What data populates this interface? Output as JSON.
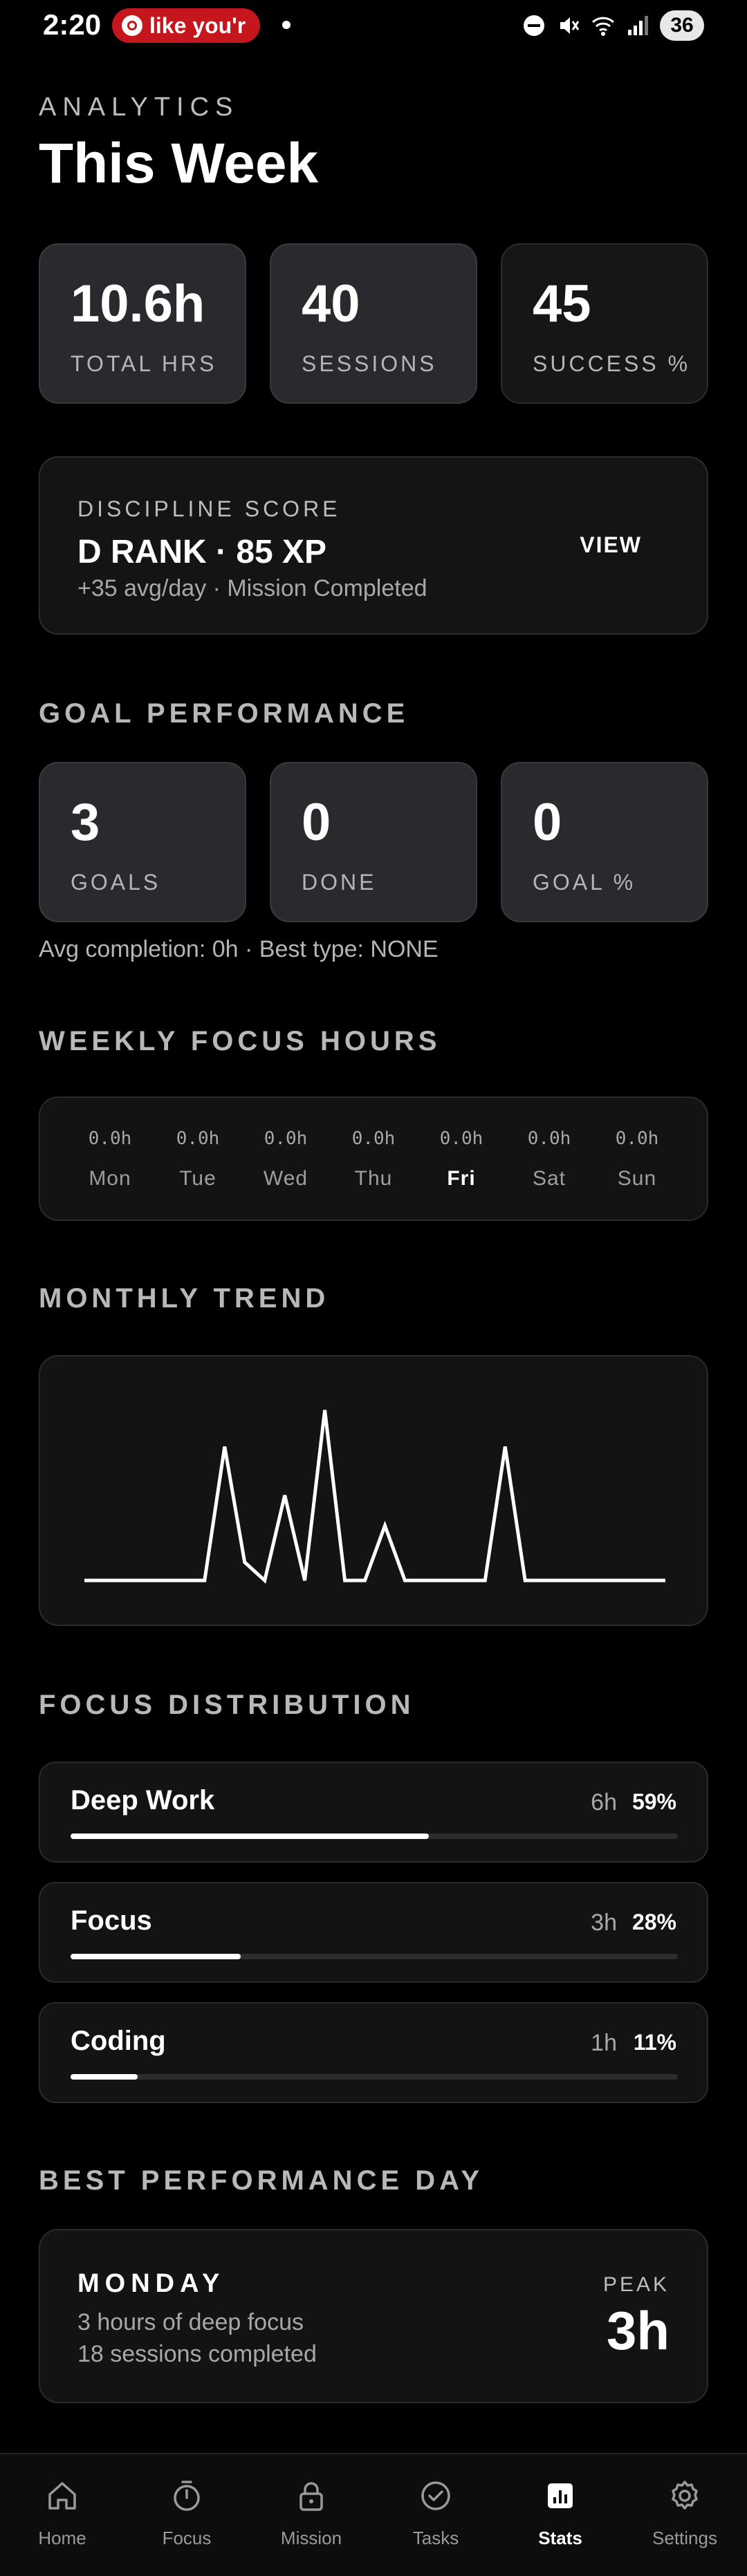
{
  "status_bar": {
    "time": "2:20",
    "notification_text": "like you'r",
    "battery": "36"
  },
  "header": {
    "eyebrow": "ANALYTICS",
    "title": "This Week"
  },
  "summary_stats": [
    {
      "value": "10.6h",
      "label": "TOTAL HRS"
    },
    {
      "value": "40",
      "label": "SESSIONS"
    },
    {
      "value": "45",
      "label": "SUCCESS %"
    }
  ],
  "discipline": {
    "eyebrow": "DISCIPLINE SCORE",
    "rank": "D RANK · 85 XP",
    "subtitle": "+35 avg/day · Mission Completed",
    "view_label": "VIEW"
  },
  "goal_performance": {
    "title": "GOAL PERFORMANCE",
    "stats": [
      {
        "value": "3",
        "label": "GOALS"
      },
      {
        "value": "0",
        "label": "DONE"
      },
      {
        "value": "0",
        "label": "GOAL %"
      }
    ],
    "note": "Avg completion: 0h · Best type: NONE"
  },
  "weekly_focus": {
    "title": "WEEKLY FOCUS HOURS",
    "days": [
      {
        "hours": "0.0h",
        "name": "Mon"
      },
      {
        "hours": "0.0h",
        "name": "Tue"
      },
      {
        "hours": "0.0h",
        "name": "Wed"
      },
      {
        "hours": "0.0h",
        "name": "Thu"
      },
      {
        "hours": "0.0h",
        "name": "Fri"
      },
      {
        "hours": "0.0h",
        "name": "Sat"
      },
      {
        "hours": "0.0h",
        "name": "Sun"
      }
    ],
    "active_day": "Fri"
  },
  "monthly_trend": {
    "title": "MONTHLY TREND"
  },
  "chart_data": {
    "type": "line",
    "title": "",
    "x": [
      1,
      2,
      3,
      4,
      5,
      6,
      7,
      8,
      9,
      10,
      11,
      12,
      13,
      14,
      15,
      16,
      17,
      18,
      19,
      20,
      21,
      22,
      23,
      24,
      25,
      26,
      27,
      28,
      29,
      30
    ],
    "series": [
      {
        "values": [
          0,
          0,
          0,
          0,
          0,
          0,
          0,
          2.2,
          0.3,
          0,
          1.4,
          0,
          2.8,
          0,
          0,
          0.9,
          0,
          0,
          0,
          0,
          0,
          2.2,
          0,
          0,
          0,
          0,
          0,
          0,
          0,
          0
        ]
      }
    ],
    "ylim": [
      0,
      3
    ],
    "grid": false,
    "legend": "none"
  },
  "focus_distribution": {
    "title": "FOCUS DISTRIBUTION",
    "items": [
      {
        "name": "Deep Work",
        "hours": "6h",
        "percent": "59%",
        "fraction": 0.59
      },
      {
        "name": "Focus",
        "hours": "3h",
        "percent": "28%",
        "fraction": 0.28
      },
      {
        "name": "Coding",
        "hours": "1h",
        "percent": "11%",
        "fraction": 0.11
      }
    ]
  },
  "best_day": {
    "title": "BEST PERFORMANCE DAY",
    "day": "MONDAY",
    "line1": "3 hours of deep focus",
    "line2": "18 sessions completed",
    "peak_label": "PEAK",
    "peak_value": "3h"
  },
  "nav": {
    "items": [
      {
        "label": "Home",
        "icon": "home-icon"
      },
      {
        "label": "Focus",
        "icon": "timer-icon"
      },
      {
        "label": "Mission",
        "icon": "lock-icon"
      },
      {
        "label": "Tasks",
        "icon": "check-circle-icon"
      },
      {
        "label": "Stats",
        "icon": "stats-icon"
      },
      {
        "label": "Settings",
        "icon": "gear-icon"
      }
    ],
    "active": "Stats"
  },
  "colors": {
    "background": "#000000",
    "card": "#131313",
    "card_highlight": "#2a2a2e",
    "accent": "#ffffff",
    "notification": "#c4161c"
  }
}
